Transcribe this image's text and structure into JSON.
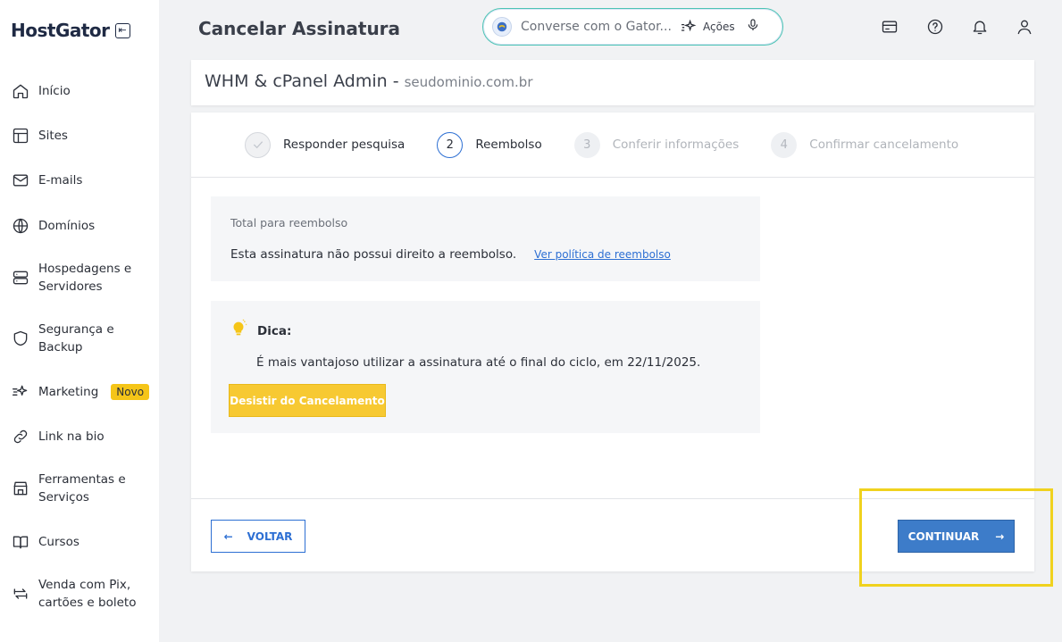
{
  "brand": {
    "name": "HostGator"
  },
  "sidebar": {
    "items": [
      {
        "label": "Início",
        "icon": "home-icon"
      },
      {
        "label": "Sites",
        "icon": "layout-icon"
      },
      {
        "label": "E-mails",
        "icon": "mail-icon"
      },
      {
        "label": "Domínios",
        "icon": "globe-icon"
      },
      {
        "label": "Hospedagens e Servidores",
        "icon": "server-icon"
      },
      {
        "label": "Segurança e Backup",
        "icon": "shield-icon"
      },
      {
        "label": "Marketing",
        "icon": "sparkle-icon",
        "badge": "Novo"
      },
      {
        "label": "Link na bio",
        "icon": "link-icon"
      },
      {
        "label": "Ferramentas e Serviços",
        "icon": "store-icon"
      },
      {
        "label": "Cursos",
        "icon": "book-icon"
      },
      {
        "label": "Venda com Pix, cartões e boleto",
        "icon": "exchange-icon"
      }
    ]
  },
  "header": {
    "title": "Cancelar Assinatura",
    "search_placeholder": "Converse com o Gator...",
    "actions_label": "Ações"
  },
  "product": {
    "name": "WHM & cPanel Admin",
    "separator": " - ",
    "domain": "seudominio.com.br"
  },
  "steps": [
    {
      "number": "✓",
      "label": "Responder pesquisa",
      "state": "done"
    },
    {
      "number": "2",
      "label": "Reembolso",
      "state": "active"
    },
    {
      "number": "3",
      "label": "Conferir informações",
      "state": "pending"
    },
    {
      "number": "4",
      "label": "Confirmar cancelamento",
      "state": "pending"
    }
  ],
  "refund": {
    "title": "Total para reembolso",
    "text": "Esta assinatura não possui direito a reembolso.",
    "link": "Ver política de reembolso"
  },
  "tip": {
    "title": "Dica:",
    "text": "É mais vantajoso utilizar a assinatura até o final do ciclo, em 22/11/2025.",
    "button": "Desistir do Cancelamento"
  },
  "footer": {
    "back": "VOLTAR",
    "continue": "CONTINUAR"
  },
  "colors": {
    "accent": "#2d6fd3",
    "primary_button": "#3d7cc9",
    "warning_button": "#f7c932",
    "highlight": "#f0d21e"
  }
}
